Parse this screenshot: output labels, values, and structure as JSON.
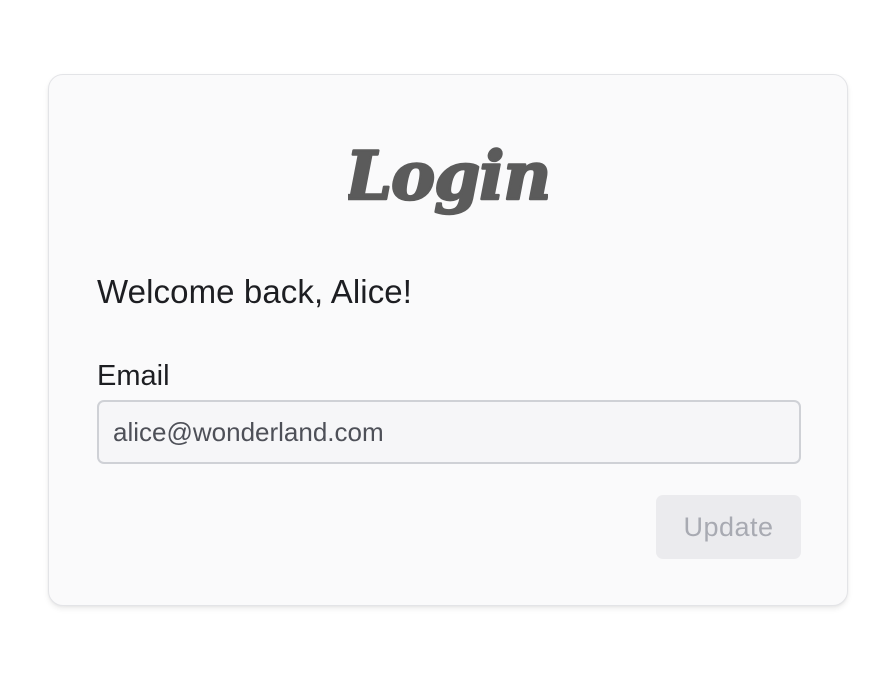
{
  "logo": {
    "text": "Login",
    "color": "#5b5b5b"
  },
  "greeting": "Welcome back, Alice!",
  "form": {
    "email_label": "Email",
    "email_value": "alice@wonderland.com"
  },
  "actions": {
    "update_label": "Update",
    "update_disabled": true
  },
  "colors": {
    "card_background": "#fafafb",
    "text": "#1d1e22",
    "button_background": "#ebebee",
    "button_text": "#a8aab2"
  }
}
